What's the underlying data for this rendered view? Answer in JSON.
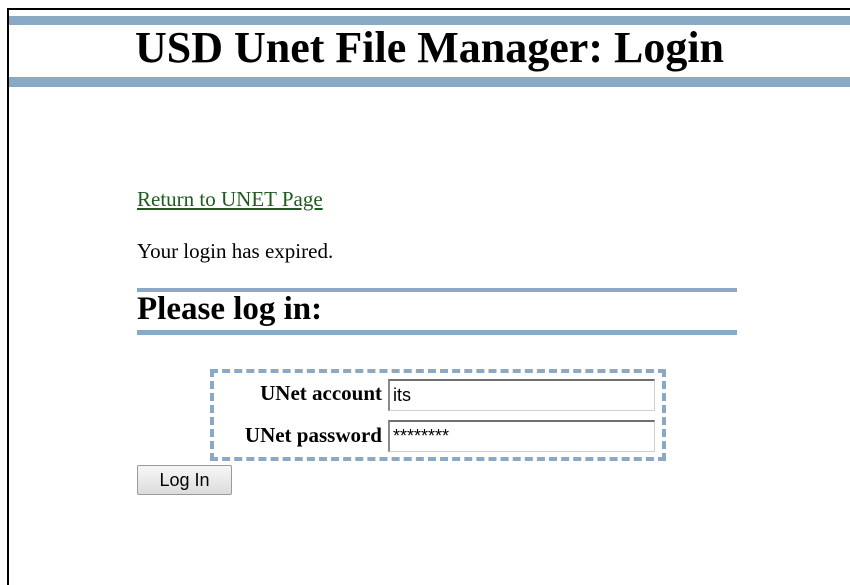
{
  "header": {
    "title": "USD Unet File Manager: Login",
    "bar_color": "#8aa9c4"
  },
  "main": {
    "return_link": "Return to UNET Page",
    "message": "Your login has expired.",
    "section_heading": "Please log in:"
  },
  "form": {
    "account_label": "UNet account",
    "account_value": "its",
    "password_label": "UNet password",
    "password_value": "********",
    "submit_label": "Log In"
  }
}
